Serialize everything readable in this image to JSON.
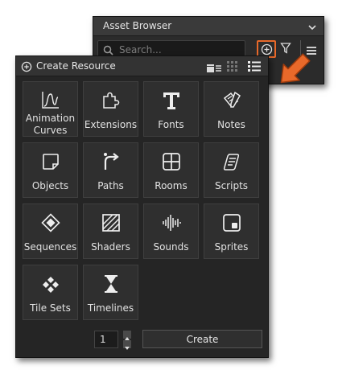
{
  "asset_browser": {
    "title": "Asset Browser",
    "search": {
      "placeholder": "Search...",
      "value": ""
    },
    "icons": [
      "chevron-down-icon",
      "search-icon",
      "add-circle-icon",
      "filter-icon",
      "menu-icon"
    ],
    "highlight_color": "#e8692a"
  },
  "create_resource": {
    "title": "Create Resource",
    "view_icons": [
      "folder-view-icon",
      "grid-view-icon",
      "list-view-icon"
    ],
    "tiles": [
      {
        "label": "Animation Curves",
        "icon": "curve-icon"
      },
      {
        "label": "Extensions",
        "icon": "puzzle-icon"
      },
      {
        "label": "Fonts",
        "icon": "font-icon"
      },
      {
        "label": "Notes",
        "icon": "notes-icon"
      },
      {
        "label": "Objects",
        "icon": "object-icon"
      },
      {
        "label": "Paths",
        "icon": "path-icon"
      },
      {
        "label": "Rooms",
        "icon": "room-icon"
      },
      {
        "label": "Scripts",
        "icon": "script-icon"
      },
      {
        "label": "Sequences",
        "icon": "sequence-icon"
      },
      {
        "label": "Shaders",
        "icon": "shader-icon"
      },
      {
        "label": "Sounds",
        "icon": "sound-icon"
      },
      {
        "label": "Sprites",
        "icon": "sprite-icon"
      },
      {
        "label": "Tile Sets",
        "icon": "tileset-icon"
      },
      {
        "label": "Timelines",
        "icon": "timeline-icon"
      }
    ],
    "quantity": "1",
    "create_label": "Create"
  },
  "colors": {
    "accent": "#e8692a",
    "panel": "#252525",
    "tile": "#2f2f2f"
  }
}
